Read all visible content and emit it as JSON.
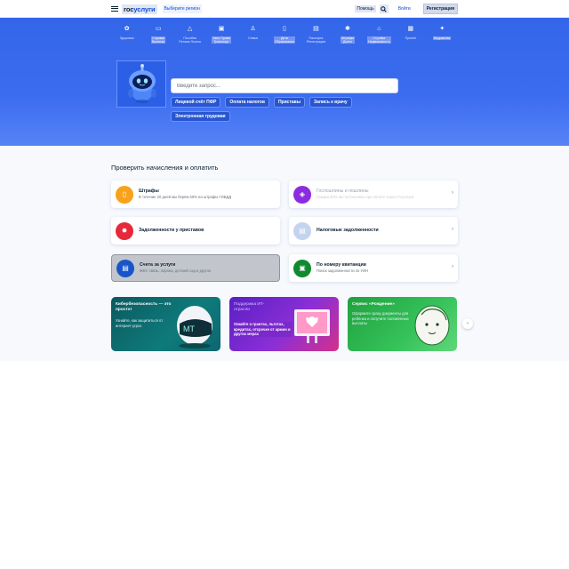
{
  "header": {
    "logo_prefix": "гос",
    "logo_suffix": "услуги",
    "region_label": "Выберите регион",
    "help_label": "Помощь",
    "login_label": "Войти",
    "register_label": "Регистрация"
  },
  "categories": [
    {
      "label": "Здоровье",
      "icon": "gear-icon",
      "highlight": false
    },
    {
      "label": "Справки\nВыписки",
      "icon": "folder-icon",
      "highlight": true
    },
    {
      "label": "Пособия\nПенсии Льготы",
      "icon": "hands-icon",
      "highlight": false
    },
    {
      "label": "Авто Права\nТранспорт",
      "icon": "car-icon",
      "highlight": true
    },
    {
      "label": "Семья",
      "icon": "family-icon",
      "highlight": false
    },
    {
      "label": "Дети\nОбразование",
      "icon": "book-icon",
      "highlight": true
    },
    {
      "label": "Паспорта\nРегистрация",
      "icon": "passport-icon",
      "highlight": false
    },
    {
      "label": "Штрафы\nДолги",
      "icon": "fine-icon",
      "highlight": true
    },
    {
      "label": "Стройка\nНедвижимость",
      "icon": "house-icon",
      "highlight": true
    },
    {
      "label": "Прочее",
      "icon": "grid-icon",
      "highlight": false
    },
    {
      "label": "Ведомства",
      "icon": "emblem-icon",
      "highlight": true
    }
  ],
  "search": {
    "placeholder": "Введите запрос..."
  },
  "quick_links": [
    "Лицевой счёт ПФР",
    "Оплата налогов",
    "Приставы",
    "Запись к врачу",
    "Электронная трудовая"
  ],
  "payments": {
    "title": "Проверить начисления и оплатить",
    "cards": [
      {
        "title": "Штрафы",
        "desc": "В течение 20 дней мы берём 50% на штрафы ГИБДД",
        "icon": "fine-icon",
        "color": "#f7a21a",
        "faint": false
      },
      {
        "title": "Госпошлины и пошлины",
        "desc": "Скидка 30% на госпошлины при оплате через Госуслуги",
        "icon": "duty-icon",
        "color": "#8c2ce0",
        "faint": true
      },
      {
        "title": "Задолженности у приставов",
        "desc": "",
        "icon": "bailiff-icon",
        "color": "#e8283a",
        "faint": false
      },
      {
        "title": "Налоговые задолженности",
        "desc": "",
        "icon": "tax-icon",
        "color": "#c4d4ef",
        "faint": false
      },
      {
        "title": "Счета за услуги",
        "desc": "ЖКУ, связь, охрана, детский сад и другое",
        "icon": "bill-icon",
        "color": "#1755c9",
        "faint": false
      },
      {
        "title": "По номеру квитанции",
        "desc": "Поиск задолженности по УИН",
        "icon": "receipt-icon",
        "color": "#0f8a2e",
        "faint": false
      }
    ]
  },
  "promos": [
    {
      "title": "Кибербезопасность — это просто!",
      "desc": "Узнайте, как защититься от интернет-угроз",
      "bg": "#0d6b6b"
    },
    {
      "title": "Поддержка ИТ-отрасли",
      "desc": "Узнайте о грантах, льготах, кредитах, отсрочке от армии и других мерах",
      "bg": "#7a25c9"
    },
    {
      "title": "Сервис «Рождение»",
      "desc": "Оформите сразу документы для ребёнка и получите положенные выплаты",
      "bg": "#2bb14a"
    }
  ],
  "colors": {
    "brand_blue": "#0d4cd3",
    "hero_blue": "#3466ea"
  }
}
